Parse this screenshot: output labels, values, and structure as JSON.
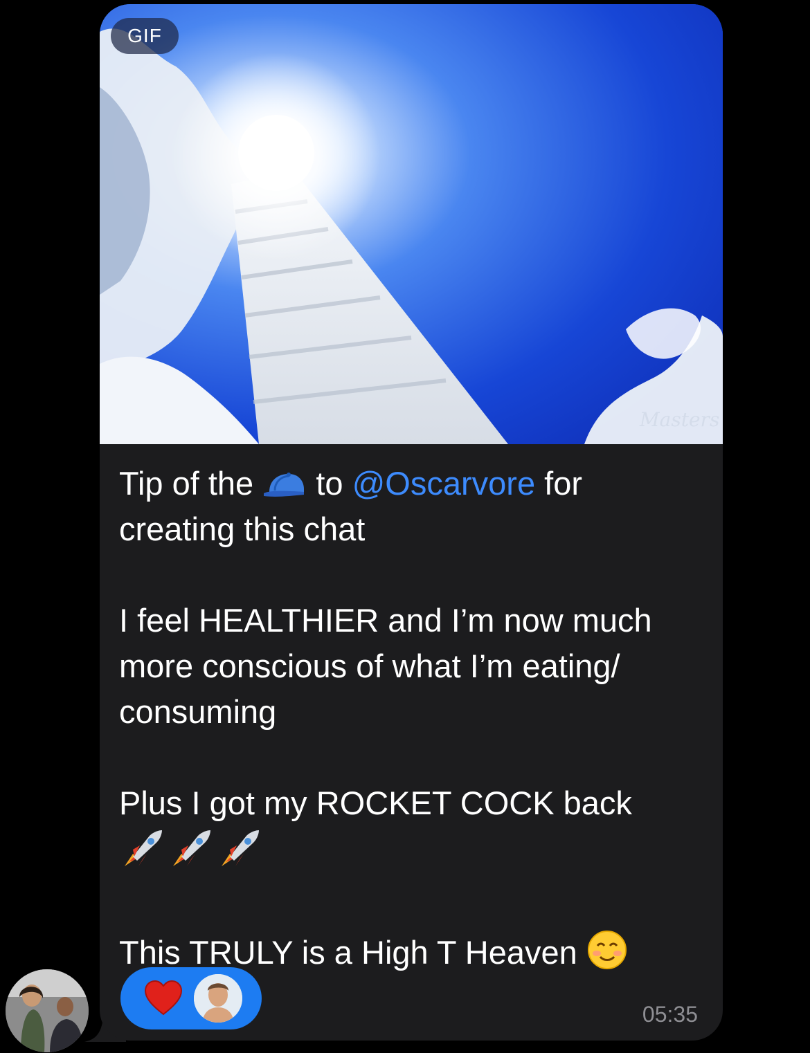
{
  "message": {
    "gif_badge": "GIF",
    "gif_watermark": "Masters",
    "text": {
      "line1_prefix": "Tip of the",
      "line1_cap_emoji": "cap-emoji",
      "line1_to": "to",
      "mention": "@Oscarvore",
      "line1_suffix": "for",
      "line2": "creating this chat",
      "para2_line1": "I feel HEALTHIER and I’m now much",
      "para2_line2": "more conscious of what I’m eating/",
      "para2_line3": "consuming",
      "para3_line1": "Plus I got my ROCKET COCK back",
      "para3_emojis": "🚀🚀🚀",
      "para4_text": "This TRULY is a High T Heaven",
      "para4_emoji": "☺️"
    },
    "reaction": {
      "emoji": "heart-icon",
      "reactor": "reactor-avatar"
    },
    "time": "05:35"
  },
  "colors": {
    "background": "#000000",
    "bubble": "#1c1c1e",
    "mention": "#3d8bfd",
    "reaction_pill": "#1d7cf2",
    "timestamp": "#8e8e93",
    "text": "#ffffff"
  }
}
